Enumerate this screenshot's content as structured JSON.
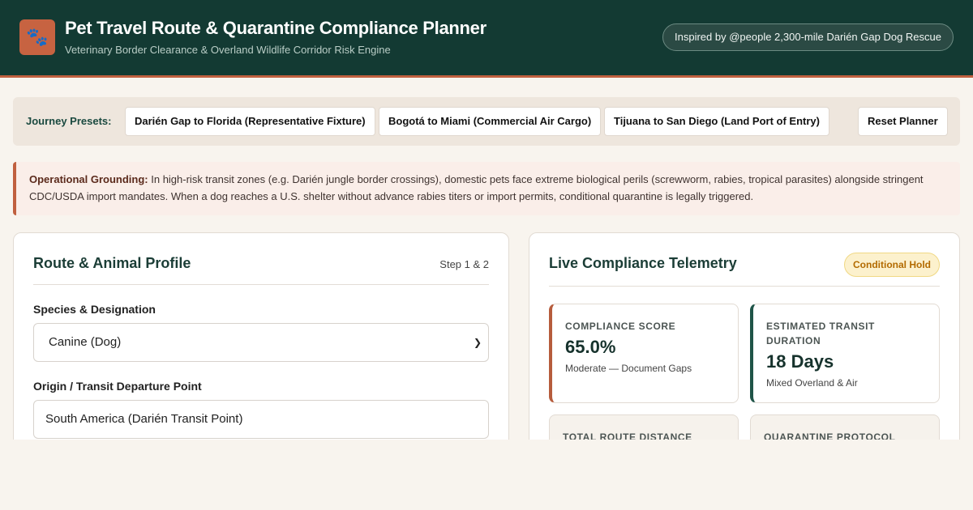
{
  "header": {
    "logo_icon": "paw-icon",
    "title": "Pet Travel Route & Quarantine Compliance Planner",
    "subtitle": "Veterinary Border Clearance & Overland Wildlife Corridor Risk Engine",
    "inspired_label": "Inspired by @people 2,300-mile Darién Gap Dog Rescue"
  },
  "presets": {
    "label": "Journey Presets:",
    "items": [
      "Darién Gap to Florida (Representative Fixture)",
      "Bogotá to Miami (Commercial Air Cargo)",
      "Tijuana to San Diego (Land Port of Entry)"
    ],
    "reset_label": "Reset Planner"
  },
  "alert": {
    "heading": "Operational Grounding:",
    "body": "In high-risk transit zones (e.g. Darién jungle border crossings), domestic pets face extreme biological perils (screwworm, rabies, tropical parasites) alongside stringent CDC/USDA import mandates. When a dog reaches a U.S. shelter without advance rabies titers or import permits, conditional quarantine is legally triggered."
  },
  "profile": {
    "title": "Route & Animal Profile",
    "step": "Step 1 & 2",
    "species_label": "Species & Designation",
    "species_value": "Canine (Dog)",
    "origin_label": "Origin / Transit Departure Point",
    "origin_value": "South America (Darién Transit Point)"
  },
  "telemetry": {
    "title": "Live Compliance Telemetry",
    "status": "Conditional Hold",
    "metrics": [
      {
        "label": "Compliance Score",
        "value": "65.0%",
        "sub": "Moderate — Document Gaps"
      },
      {
        "label": "Estimated Transit Duration",
        "value": "18 Days",
        "sub": "Mixed Overland & Air"
      },
      {
        "label": "Total Route Distance"
      },
      {
        "label": "Quarantine Protocol"
      }
    ]
  },
  "colors": {
    "header_bg": "#133a33",
    "accent": "#c0603f",
    "status_warning": "#b36b00"
  }
}
